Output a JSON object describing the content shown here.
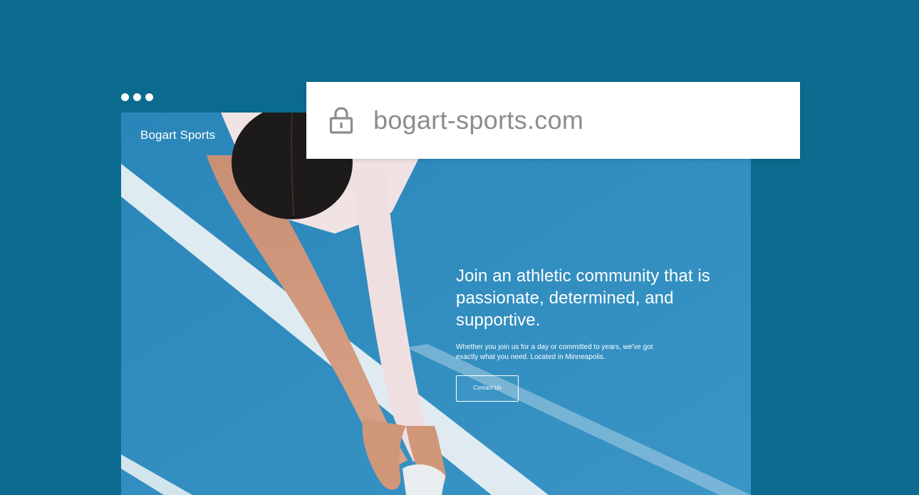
{
  "window": {
    "controls": [
      "dot",
      "dot",
      "dot"
    ]
  },
  "browser": {
    "url": "bogart-sports.com",
    "lock_icon": "lock-icon"
  },
  "site": {
    "logo": "Bogart Sports",
    "hero": {
      "headline": "Join an athletic community that is passionate, determined, and supportive.",
      "subtext": "Whether you join us for a day or committed to years, we've got exactly what you need. Located in Minneapolis.",
      "cta_label": "Contact Us"
    }
  },
  "colors": {
    "page_background": "#0b6b8e",
    "track_blue": "#2f8bbd",
    "lane_line": "#eef3f5",
    "text_on_hero": "#ffffff",
    "url_text": "#8c8c8c"
  }
}
